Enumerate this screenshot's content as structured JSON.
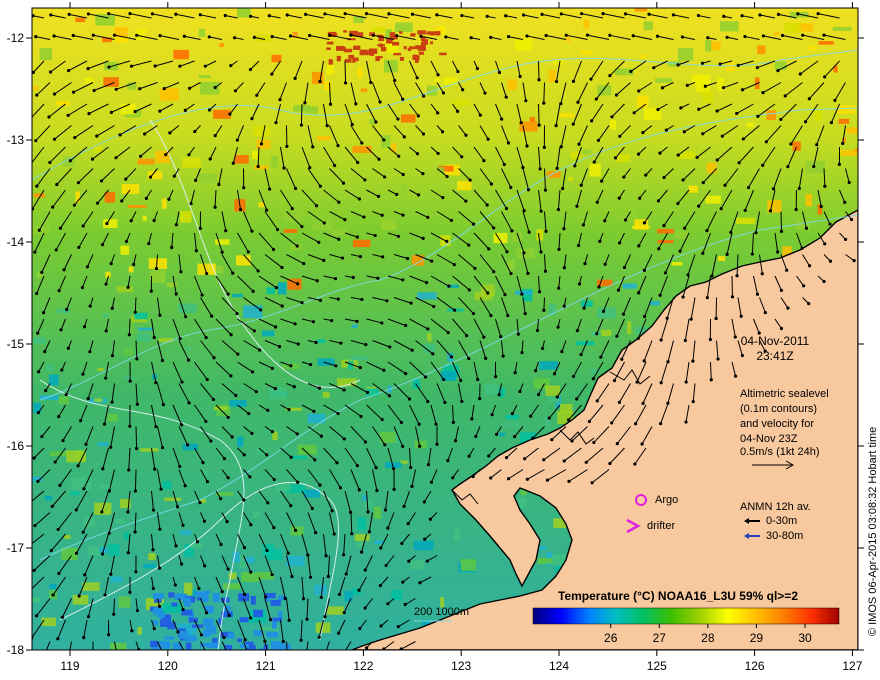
{
  "map": {
    "lon_ticks": [
      "119",
      "120",
      "121",
      "122",
      "123",
      "124",
      "125",
      "126",
      "127"
    ],
    "lat_ticks": [
      "-12",
      "-13",
      "-14",
      "-15",
      "-16",
      "-17",
      "-18"
    ],
    "colors": {
      "land": "#f8c89e",
      "coast": "#000000",
      "sealevel_contour": "#e8f4ff",
      "depth_contour": "#7fd8e8",
      "vector": "#000000",
      "argo": "#e020e0",
      "drifter": "#e020e0",
      "anmn_deep": "#1f3fbf"
    }
  },
  "annotation": {
    "date": "04-Nov-2011",
    "time": "23:41Z",
    "altimetry": [
      "Altimetric sealevel",
      "(0.1m contours)",
      "and velocity for",
      "04-Nov 23Z",
      "0.5m/s (1kt 24h)"
    ]
  },
  "legend": {
    "argo": "Argo",
    "drifter": "drifter",
    "anmn_title": "ANMN 12h av.",
    "anmn_shallow": "0-30m",
    "anmn_deep": "30-80m",
    "bathy": "200  1000m"
  },
  "colorbar": {
    "title": "Temperature (°C) NOAA16_L3U 59% ql>=2",
    "ticks": [
      "26",
      "27",
      "28",
      "29",
      "30"
    ],
    "colors": [
      "#000080",
      "#0000ff",
      "#0080ff",
      "#00c0c0",
      "#00c060",
      "#40c000",
      "#a0d000",
      "#ffff00",
      "#ffc000",
      "#ff8000",
      "#ff3000",
      "#a00000"
    ]
  },
  "credit": "© IMOS 06-Apr-2015 03:08:32 Hobart time"
}
